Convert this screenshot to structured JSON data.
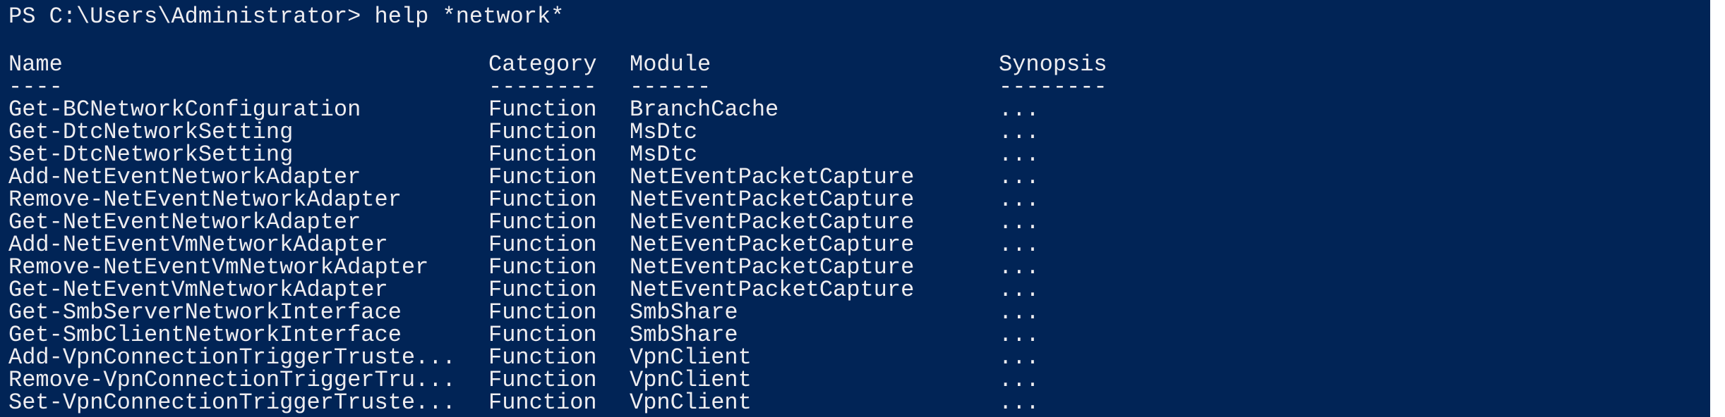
{
  "terminal": {
    "prompt": "PS C:\\Users\\Administrator> help *network*",
    "headers": {
      "name": "Name",
      "category": "Category",
      "module": "Module",
      "synopsis": "Synopsis"
    },
    "underlines": {
      "name": "----",
      "category": "--------",
      "module": "------",
      "synopsis": "--------"
    },
    "rows": [
      {
        "name": "Get-BCNetworkConfiguration",
        "category": "Function",
        "module": "BranchCache",
        "synopsis": "..."
      },
      {
        "name": "Get-DtcNetworkSetting",
        "category": "Function",
        "module": "MsDtc",
        "synopsis": "..."
      },
      {
        "name": "Set-DtcNetworkSetting",
        "category": "Function",
        "module": "MsDtc",
        "synopsis": "..."
      },
      {
        "name": "Add-NetEventNetworkAdapter",
        "category": "Function",
        "module": "NetEventPacketCapture",
        "synopsis": "..."
      },
      {
        "name": "Remove-NetEventNetworkAdapter",
        "category": "Function",
        "module": "NetEventPacketCapture",
        "synopsis": "..."
      },
      {
        "name": "Get-NetEventNetworkAdapter",
        "category": "Function",
        "module": "NetEventPacketCapture",
        "synopsis": "..."
      },
      {
        "name": "Add-NetEventVmNetworkAdapter",
        "category": "Function",
        "module": "NetEventPacketCapture",
        "synopsis": "..."
      },
      {
        "name": "Remove-NetEventVmNetworkAdapter",
        "category": "Function",
        "module": "NetEventPacketCapture",
        "synopsis": "..."
      },
      {
        "name": "Get-NetEventVmNetworkAdapter",
        "category": "Function",
        "module": "NetEventPacketCapture",
        "synopsis": "..."
      },
      {
        "name": "Get-SmbServerNetworkInterface",
        "category": "Function",
        "module": "SmbShare",
        "synopsis": "..."
      },
      {
        "name": "Get-SmbClientNetworkInterface",
        "category": "Function",
        "module": "SmbShare",
        "synopsis": "..."
      },
      {
        "name": "Add-VpnConnectionTriggerTruste...",
        "category": "Function",
        "module": "VpnClient",
        "synopsis": "..."
      },
      {
        "name": "Remove-VpnConnectionTriggerTru...",
        "category": "Function",
        "module": "VpnClient",
        "synopsis": "..."
      },
      {
        "name": "Set-VpnConnectionTriggerTruste...",
        "category": "Function",
        "module": "VpnClient",
        "synopsis": "..."
      }
    ]
  },
  "colors": {
    "background": "#012456",
    "foreground": "#eeedf0"
  }
}
